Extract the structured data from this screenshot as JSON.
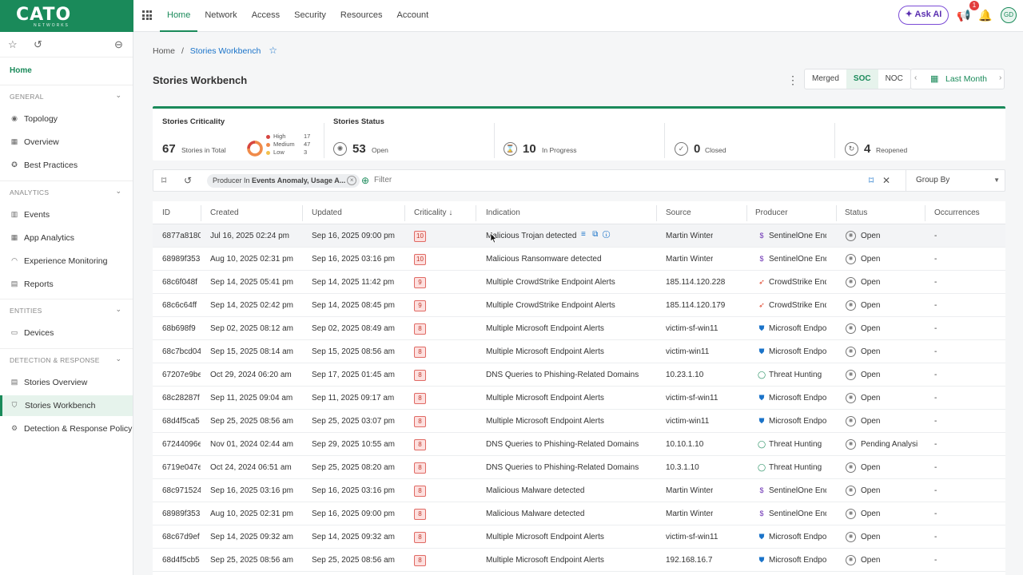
{
  "app": {
    "logo": "CATO",
    "logo_sub": "NETWORKS"
  },
  "nav": [
    "Home",
    "Network",
    "Access",
    "Security",
    "Resources",
    "Account"
  ],
  "top": {
    "ask_ai": "Ask AI",
    "notification_count": "1",
    "avatar": "GD"
  },
  "sidebar": {
    "home": "Home",
    "sections": [
      {
        "label": "GENERAL",
        "items": [
          "Topology",
          "Overview",
          "Best Practices"
        ]
      },
      {
        "label": "ANALYTICS",
        "items": [
          "Events",
          "App Analytics",
          "Experience Monitoring",
          "Reports"
        ]
      },
      {
        "label": "ENTITIES",
        "items": [
          "Devices"
        ]
      },
      {
        "label": "DETECTION & RESPONSE",
        "items": [
          "Stories Overview",
          "Stories Workbench",
          "Detection & Response Policy"
        ]
      }
    ]
  },
  "breadcrumb": {
    "home": "Home",
    "sep": "/",
    "current": "Stories Workbench"
  },
  "page_title": "Stories Workbench",
  "view_toggle": {
    "options": [
      "Merged",
      "SOC",
      "NOC"
    ],
    "selected": "SOC"
  },
  "time_range": "Last Month",
  "stats": {
    "criticality_label": "Stories Criticality",
    "total": "67",
    "total_label": "Stories in Total",
    "breakdown": [
      {
        "name": "High",
        "count": "17",
        "color": "#d64541"
      },
      {
        "name": "Medium",
        "count": "47",
        "color": "#f08a4b"
      },
      {
        "name": "Low",
        "count": "3",
        "color": "#f2c14e"
      }
    ],
    "status_label": "Stories Status",
    "open": "53",
    "open_label": "Open",
    "in_progress": "10",
    "in_progress_label": "In Progress",
    "closed": "0",
    "closed_label": "Closed",
    "reopened": "4",
    "reopened_label": "Reopened"
  },
  "filter": {
    "chip_prefix": "Producer In ",
    "chip_value": "Events Anomaly, Usage A...",
    "placeholder": "Filter",
    "group_by": "Group By"
  },
  "table": {
    "headers": [
      "ID",
      "Created",
      "Updated",
      "Criticality",
      "Indication",
      "Source",
      "Producer",
      "Status",
      "Occurrences"
    ],
    "rows": [
      {
        "id": "6877a8180",
        "created": "Jul 16, 2025 02:24 pm",
        "updated": "Sep 16, 2025 09:00 pm",
        "crit": "10",
        "indication": "Malicious Trojan detected",
        "source": "Martin Winter",
        "producer": "SentinelOne End",
        "status": "Open",
        "occ": "-"
      },
      {
        "id": "68989f353",
        "created": "Aug 10, 2025 02:31 pm",
        "updated": "Sep 16, 2025 03:16 pm",
        "crit": "10",
        "indication": "Malicious Ransomware detected",
        "source": "Martin Winter",
        "producer": "SentinelOne End",
        "status": "Open",
        "occ": "-"
      },
      {
        "id": "68c6f048f",
        "created": "Sep 14, 2025 05:41 pm",
        "updated": "Sep 14, 2025 11:42 pm",
        "crit": "9",
        "indication": "Multiple CrowdStrike Endpoint Alerts",
        "source": "185.114.120.228",
        "producer": "CrowdStrike End",
        "status": "Open",
        "occ": "-"
      },
      {
        "id": "68c6c64ff",
        "created": "Sep 14, 2025 02:42 pm",
        "updated": "Sep 14, 2025 08:45 pm",
        "crit": "9",
        "indication": "Multiple CrowdStrike Endpoint Alerts",
        "source": "185.114.120.179",
        "producer": "CrowdStrike End",
        "status": "Open",
        "occ": "-"
      },
      {
        "id": "68b698f9",
        "created": "Sep 02, 2025 08:12 am",
        "updated": "Sep 02, 2025 08:49 am",
        "crit": "8",
        "indication": "Multiple Microsoft Endpoint Alerts",
        "source": "victim-sf-win11",
        "producer": "Microsoft Endpo",
        "status": "Open",
        "occ": "-"
      },
      {
        "id": "68c7bcd04",
        "created": "Sep 15, 2025 08:14 am",
        "updated": "Sep 15, 2025 08:56 am",
        "crit": "8",
        "indication": "Multiple Microsoft Endpoint Alerts",
        "source": "victim-win11",
        "producer": "Microsoft Endpo",
        "status": "Open",
        "occ": "-"
      },
      {
        "id": "67207e9be",
        "created": "Oct 29, 2024 06:20 am",
        "updated": "Sep 17, 2025 01:45 am",
        "crit": "8",
        "indication": "DNS Queries to Phishing-Related Domains",
        "source": "10.23.1.10",
        "producer": "Threat Hunting",
        "status": "Open",
        "occ": "-"
      },
      {
        "id": "68c28287f",
        "created": "Sep 11, 2025 09:04 am",
        "updated": "Sep 11, 2025 09:17 am",
        "crit": "8",
        "indication": "Multiple Microsoft Endpoint Alerts",
        "source": "victim-sf-win11",
        "producer": "Microsoft Endpo",
        "status": "Open",
        "occ": "-"
      },
      {
        "id": "68d4f5ca5",
        "created": "Sep 25, 2025 08:56 am",
        "updated": "Sep 25, 2025 03:07 pm",
        "crit": "8",
        "indication": "Multiple Microsoft Endpoint Alerts",
        "source": "victim-win11",
        "producer": "Microsoft Endpo",
        "status": "Open",
        "occ": "-"
      },
      {
        "id": "67244096e",
        "created": "Nov 01, 2024 02:44 am",
        "updated": "Sep 29, 2025 10:55 am",
        "crit": "8",
        "indication": "DNS Queries to Phishing-Related Domains",
        "source": "10.10.1.10",
        "producer": "Threat Hunting",
        "status": "Pending Analysi",
        "occ": "-"
      },
      {
        "id": "6719e047e",
        "created": "Oct 24, 2024 06:51 am",
        "updated": "Sep 25, 2025 08:20 am",
        "crit": "8",
        "indication": "DNS Queries to Phishing-Related Domains",
        "source": "10.3.1.10",
        "producer": "Threat Hunting",
        "status": "Open",
        "occ": "-"
      },
      {
        "id": "68c971524",
        "created": "Sep 16, 2025 03:16 pm",
        "updated": "Sep 16, 2025 03:16 pm",
        "crit": "8",
        "indication": "Malicious Malware detected",
        "source": "Martin Winter",
        "producer": "SentinelOne End",
        "status": "Open",
        "occ": "-"
      },
      {
        "id": "68989f353",
        "created": "Aug 10, 2025 02:31 pm",
        "updated": "Sep 16, 2025 09:00 pm",
        "crit": "8",
        "indication": "Malicious Malware detected",
        "source": "Martin Winter",
        "producer": "SentinelOne End",
        "status": "Open",
        "occ": "-"
      },
      {
        "id": "68c67d9ef",
        "created": "Sep 14, 2025 09:32 am",
        "updated": "Sep 14, 2025 09:32 am",
        "crit": "8",
        "indication": "Multiple Microsoft Endpoint Alerts",
        "source": "victim-sf-win11",
        "producer": "Microsoft Endpo",
        "status": "Open",
        "occ": "-"
      },
      {
        "id": "68d4f5cb5",
        "created": "Sep 25, 2025 08:56 am",
        "updated": "Sep 25, 2025 08:56 am",
        "crit": "8",
        "indication": "Multiple Microsoft Endpoint Alerts",
        "source": "192.168.16.7",
        "producer": "Microsoft Endpo",
        "status": "Open",
        "occ": "-"
      }
    ]
  },
  "colors": {
    "brand": "#1a8a5a",
    "link": "#1a73c9",
    "critical": "#d64541"
  }
}
